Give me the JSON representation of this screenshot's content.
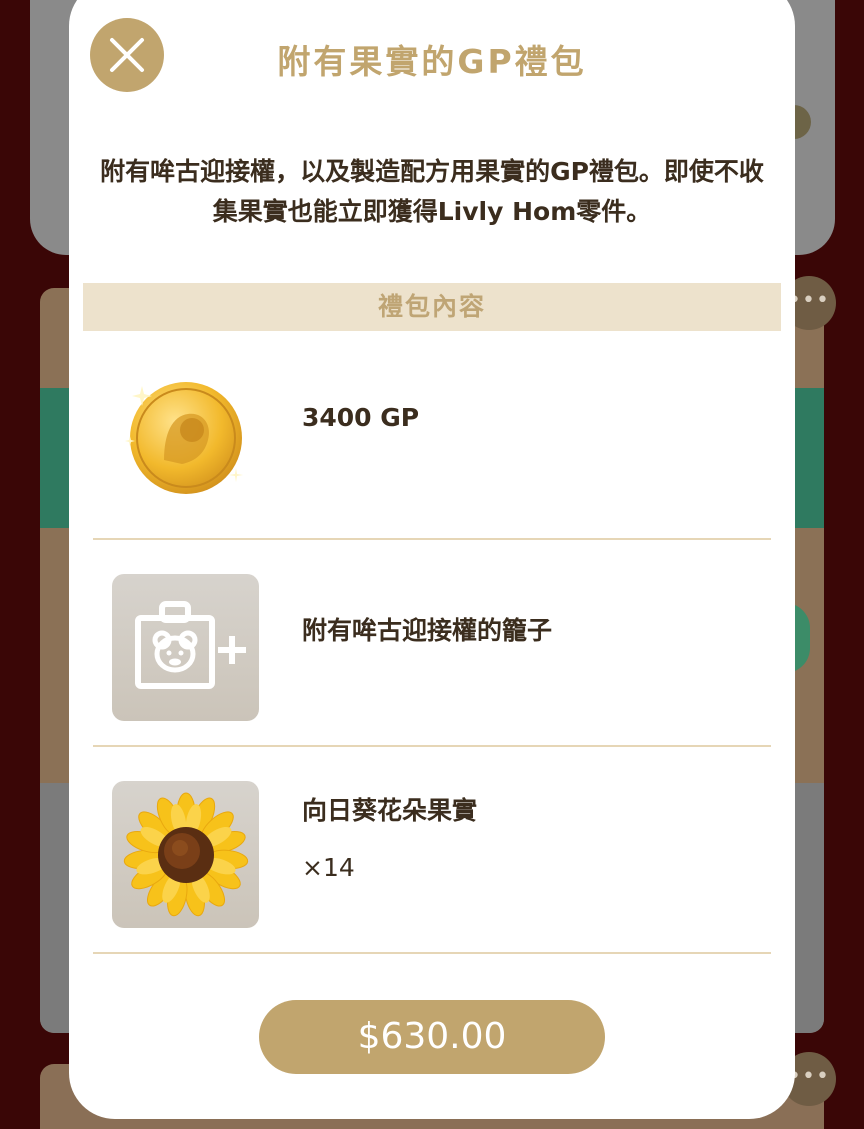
{
  "modal": {
    "title": "附有果實的GP禮包",
    "description": "附有哞古迎接權，以及製造配方用果實的GP禮包。即使不收集果實也能立即獲得Livly Hom零件。",
    "section_header": "禮包內容",
    "items": [
      {
        "name": "3400 GP",
        "quantity": "",
        "icon": "gp-coin-icon"
      },
      {
        "name": "附有哞古迎接權的籠子",
        "quantity": "",
        "icon": "cage-plus-icon"
      },
      {
        "name": "向日葵花朵果實",
        "quantity": "×14",
        "icon": "sunflower-icon"
      }
    ],
    "price_label": "$630.00"
  },
  "colors": {
    "accent": "#c1a56e",
    "section_bg": "#ede2cc",
    "text_dark": "#3b2d1e",
    "backdrop": "#3a0606"
  }
}
